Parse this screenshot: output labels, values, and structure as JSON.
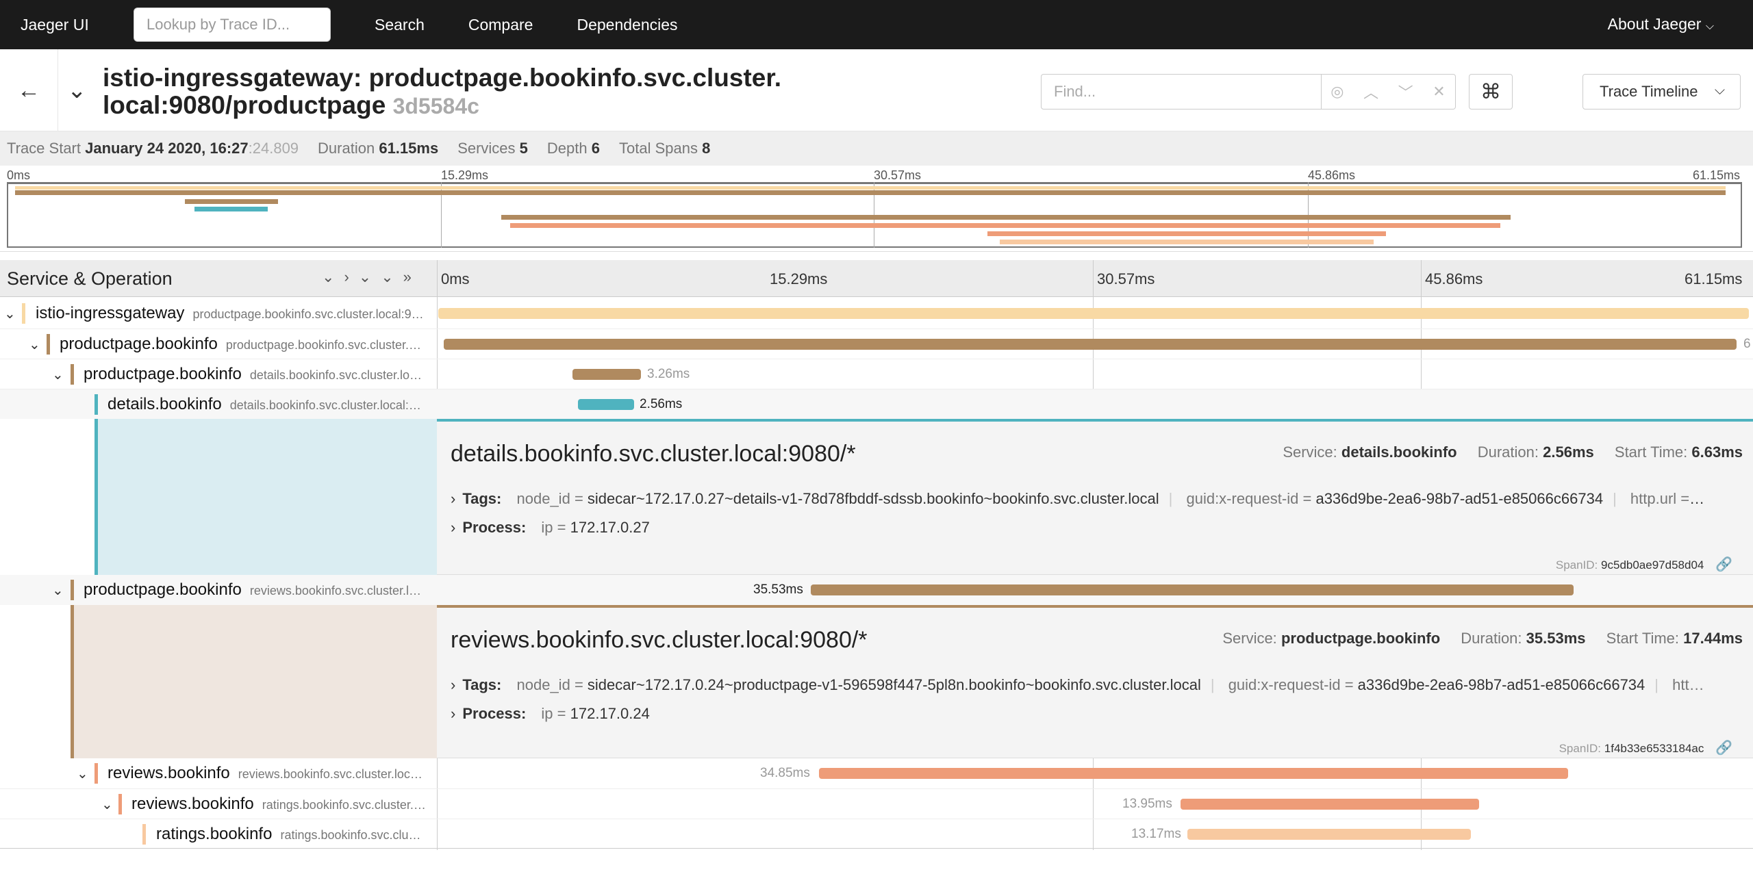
{
  "nav": {
    "brand": "Jaeger UI",
    "lookup_placeholder": "Lookup by Trace ID...",
    "links": [
      "Search",
      "Compare",
      "Dependencies"
    ],
    "about": "About Jaeger"
  },
  "trace": {
    "title_line1": "istio-ingressgateway: productpage.bookinfo.svc.cluster.",
    "title_line2": "local:9080/productpage",
    "trace_id": "3d5584c",
    "find_placeholder": "Find...",
    "view_select": "Trace Timeline"
  },
  "meta": {
    "trace_start_label": "Trace Start",
    "trace_start_value": "January 24 2020, 16:27",
    "trace_start_secs": ":24.809",
    "duration_label": "Duration",
    "duration_value": "61.15ms",
    "services_label": "Services",
    "services_value": "5",
    "depth_label": "Depth",
    "depth_value": "6",
    "spans_label": "Total Spans",
    "spans_value": "8"
  },
  "ticks": [
    "0ms",
    "15.29ms",
    "30.57ms",
    "45.86ms",
    "61.15ms"
  ],
  "header": {
    "service_operation": "Service & Operation"
  },
  "rows": [
    {
      "service": "istio-ingressgateway",
      "operation": "productpage.bookinfo.svc.cluster.local:9…",
      "duration": "",
      "color": "#f8d9a4"
    },
    {
      "service": "productpage.bookinfo",
      "operation": "productpage.bookinfo.svc.cluster.…",
      "duration": "6",
      "color": "#b08a5f"
    },
    {
      "service": "productpage.bookinfo",
      "operation": "details.bookinfo.svc.cluster.lo…",
      "duration": "3.26ms",
      "color": "#b08a5f"
    },
    {
      "service": "details.bookinfo",
      "operation": "details.bookinfo.svc.cluster.local:…",
      "duration": "2.56ms",
      "color": "#4fb3bf"
    },
    {
      "service": "productpage.bookinfo",
      "operation": "reviews.bookinfo.svc.cluster.l…",
      "duration": "35.53ms",
      "color": "#b08a5f"
    },
    {
      "service": "reviews.bookinfo",
      "operation": "reviews.bookinfo.svc.cluster.loc…",
      "duration": "34.85ms",
      "color": "#ee9c78"
    },
    {
      "service": "reviews.bookinfo",
      "operation": "ratings.bookinfo.svc.cluster.…",
      "duration": "13.95ms",
      "color": "#ee9c78"
    },
    {
      "service": "ratings.bookinfo",
      "operation": "ratings.bookinfo.svc.clu…",
      "duration": "13.17ms",
      "color": "#f8c9a0"
    }
  ],
  "detail1": {
    "title": "details.bookinfo.svc.cluster.local:9080/*",
    "service_label": "Service:",
    "service": "details.bookinfo",
    "duration_label": "Duration:",
    "duration": "2.56ms",
    "start_label": "Start Time:",
    "start": "6.63ms",
    "tags_label": "Tags:",
    "tag1_k": "node_id",
    "tag1_v": "sidecar~172.17.0.27~details-v1-78d78fbddf-sdssb.bookinfo~bookinfo.svc.cluster.local",
    "tag2_k": "guid:x-request-id",
    "tag2_v": "a336d9be-2ea6-98b7-ad51-e85066c66734",
    "tag3_k": "http.url",
    "tag3_v": "…",
    "process_label": "Process:",
    "proc_k": "ip",
    "proc_v": "172.17.0.27",
    "spanid_label": "SpanID:",
    "spanid": "9c5db0ae97d58d04"
  },
  "detail2": {
    "title": "reviews.bookinfo.svc.cluster.local:9080/*",
    "service_label": "Service:",
    "service": "productpage.bookinfo",
    "duration_label": "Duration:",
    "duration": "35.53ms",
    "start_label": "Start Time:",
    "start": "17.44ms",
    "tags_label": "Tags:",
    "tag1_k": "node_id",
    "tag1_v": "sidecar~172.17.0.24~productpage-v1-596598f447-5pl8n.bookinfo~bookinfo.svc.cluster.local",
    "tag2_k": "guid:x-request-id",
    "tag2_v": "a336d9be-2ea6-98b7-ad51-e85066c66734",
    "tag3_k": "htt…",
    "tag3_v": "",
    "process_label": "Process:",
    "proc_k": "ip",
    "proc_v": "172.17.0.24",
    "spanid_label": "SpanID:",
    "spanid": "1f4b33e6533184ac"
  }
}
